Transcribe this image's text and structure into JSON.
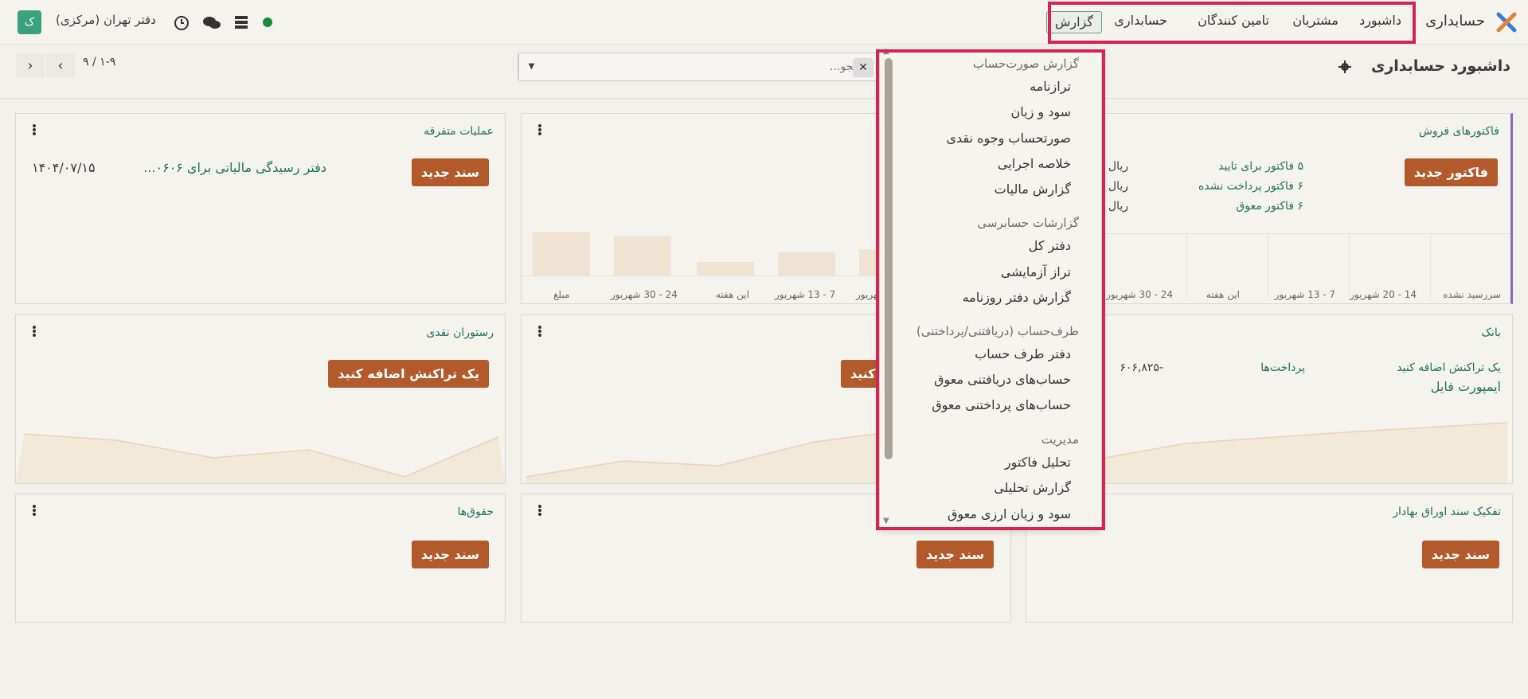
{
  "app": {
    "name": "حسابداری"
  },
  "nav": {
    "items": [
      "داشبورد",
      "مشتریان",
      "تامین کنندگان",
      "حسابداری"
    ],
    "active": "گزارش"
  },
  "systray": {
    "company": "دفتر تهران (مرکزی)",
    "avatar_letter": "ک",
    "status_color": "#1a8b36"
  },
  "control": {
    "title": "داشبورد حسابداری",
    "search_placeholder": "جستجو...",
    "pager": "۱-۹ / ۹"
  },
  "cards": {
    "sales": {
      "title": "فاکتورهای فروش",
      "button": "فاکتور جدید",
      "links": [
        "۵ فاکتور برای تایید",
        "۶ فاکتور پرداخت نشده",
        "۶ فاکتور معوق"
      ],
      "amounts": [
        "ریال",
        "ریال",
        "ریال"
      ],
      "axis": [
        "سررسید نشده",
        "14 - 20 شهریور",
        "7 - 13 شهریور",
        "این هفته",
        "24 - 30 شهریور"
      ]
    },
    "purchase": {
      "axis": [
        "مبلغ",
        "24 - 30 شهریور",
        "این هفته",
        "7 - 13 شهریور",
        "شهریور"
      ]
    },
    "misc": {
      "title": "عملیات متفرقه",
      "button": "سند جدید",
      "entry_text": "دفتر رسیدگی مالیاتی برای ۰۶۰۶...",
      "entry_date": "۱۴۰۴/۰۷/۱۵"
    },
    "bank": {
      "title": "بانک",
      "add_tx": "یک تراکنش اضافه کنید",
      "import": "ایمپورت فایل",
      "payments": "پرداخت‌ها",
      "amount": "-۶۰۶,۸۲۵"
    },
    "cash_middle": {
      "button_partial": "کنید"
    },
    "cash_restaurant": {
      "title": "رستوران نقدی",
      "button": "یک تراکنش اضافه کنید"
    },
    "securities": {
      "title": "تفکیک سند اوراق بهادار",
      "button": "سند جدید"
    },
    "middle_bottom": {
      "button": "سند جدید"
    },
    "payroll": {
      "title": "حقوق‌ها",
      "button": "سند جدید"
    }
  },
  "dropdown": {
    "sections": [
      {
        "header": "گزارش صورت‌حساب",
        "items": [
          "ترازنامه",
          "سود و زیان",
          "صورتحساب وجوه نقدی",
          "خلاصه اجرایی",
          "گزارش مالیات"
        ]
      },
      {
        "header": "گزارشات حسابرسی",
        "items": [
          "دفتر کل",
          "تراز آزمایشی",
          "گزارش دفتر روزنامه"
        ]
      },
      {
        "header": "طرف‌حساب (دریافتنی/پرداختنی)",
        "items": [
          "دفتر طرف حساب",
          "حساب‌های دریافتنی معوق",
          "حساب‌های پرداختنی معوق"
        ]
      },
      {
        "header": "مدیریت",
        "items": [
          "تحلیل فاکتور",
          "گزارش تحلیلی",
          "سود و زیان ارزی معوق"
        ]
      }
    ]
  }
}
